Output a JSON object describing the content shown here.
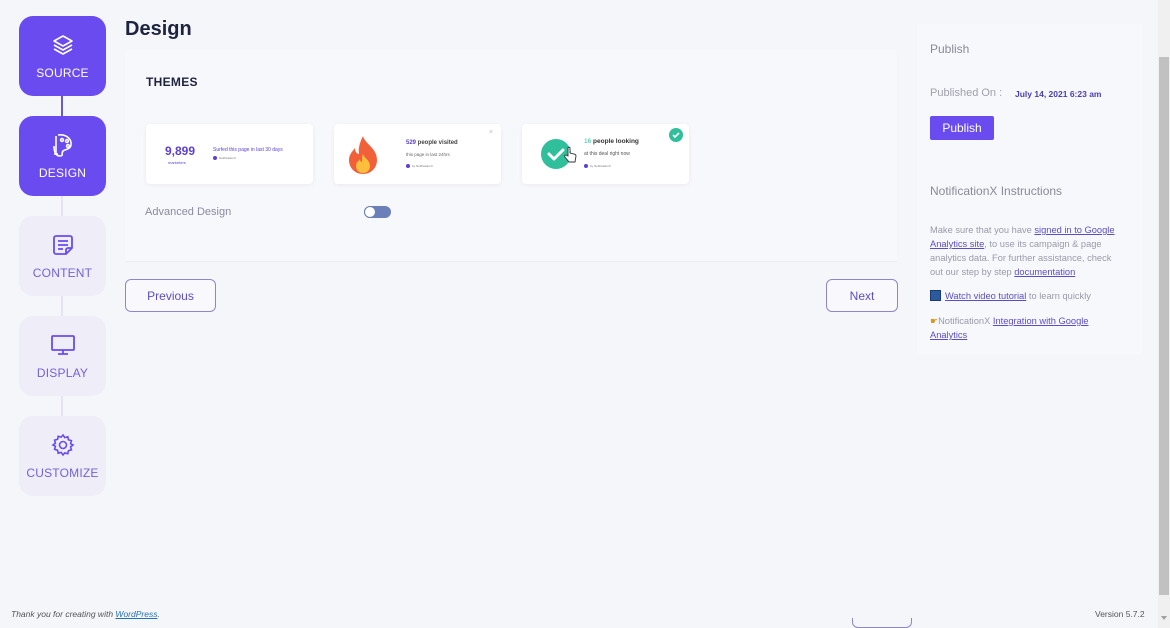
{
  "steps": [
    {
      "label": "SOURCE",
      "icon": "layers-icon",
      "state": "done"
    },
    {
      "label": "DESIGN",
      "icon": "palette-icon",
      "state": "active"
    },
    {
      "label": "CONTENT",
      "icon": "note-icon",
      "state": "pending"
    },
    {
      "label": "DISPLAY",
      "icon": "monitor-icon",
      "state": "pending"
    },
    {
      "label": "CUSTOMIZE",
      "icon": "gear-icon",
      "state": "pending"
    }
  ],
  "main": {
    "title": "Design",
    "themes_label": "THEMES",
    "themes": [
      {
        "big_number": "9,899",
        "sub": "marketers",
        "line": "Surfed this page in last 30 days",
        "by": "NotificationX"
      },
      {
        "count": "529",
        "line1": " people visited",
        "line2": "this page in last 24hrs",
        "by": "by NotificationX"
      },
      {
        "count": "16",
        "line1": " people looking",
        "line2": "at this deal right now",
        "by": "by NotificationX",
        "selected": true
      }
    ],
    "advanced_design_label": "Advanced Design",
    "advanced_design_on": false,
    "previous_label": "Previous",
    "next_label": "Next"
  },
  "sidebar": {
    "publish_title": "Publish",
    "published_on_label": "Published On :",
    "published_on_value": "July 14, 2021 6:23 am",
    "publish_button": "Publish",
    "instructions_title": "NotificationX Instructions",
    "instr_p1_a": "Make sure that you have ",
    "instr_p1_link": "signed in to Google Analytics site",
    "instr_p1_b": ", to use its campaign & page analytics data. For further assistance, check out our step by step ",
    "instr_p1_link2": "documentation",
    "video_link": "Watch video tutorial",
    "video_rest": " to learn quickly",
    "integration_prefix": "NotificationX ",
    "integration_link": "Integration with Google Analytics"
  },
  "footer": {
    "thanks_prefix": "Thank you for creating with ",
    "thanks_link": "WordPress",
    "thanks_suffix": ".",
    "version": "Version 5.7.2"
  },
  "colors": {
    "accent": "#6a4bf0",
    "success": "#2fbf9a"
  }
}
